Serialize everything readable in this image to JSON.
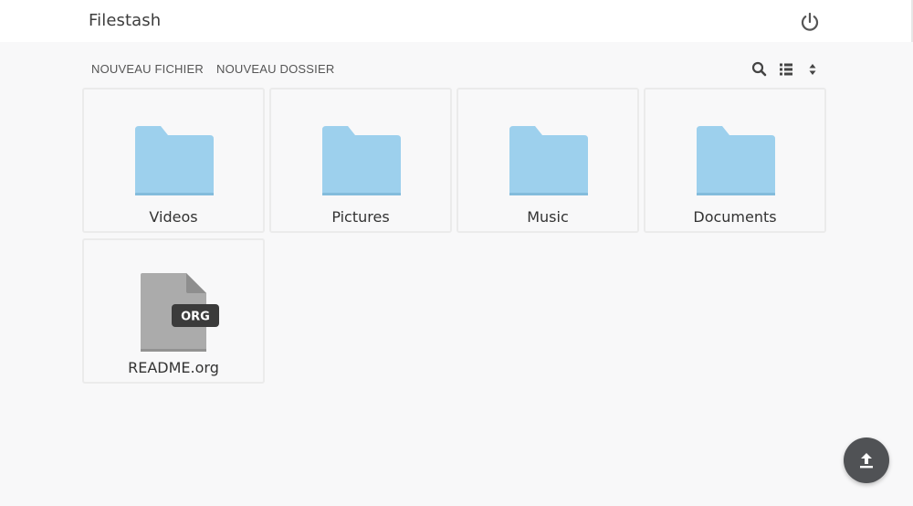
{
  "app": {
    "title": "Filestash"
  },
  "toolbar": {
    "new_file_label": "NOUVEAU FICHIER",
    "new_folder_label": "NOUVEAU DOSSIER",
    "icons": [
      "search-icon",
      "list-view-icon",
      "sort-icon"
    ]
  },
  "files": [
    {
      "name": "Videos",
      "type": "folder"
    },
    {
      "name": "Pictures",
      "type": "folder"
    },
    {
      "name": "Music",
      "type": "folder"
    },
    {
      "name": "Documents",
      "type": "folder"
    },
    {
      "name": "README.org",
      "type": "file",
      "badge": "ORG"
    }
  ],
  "colors": {
    "folder": "#9dd0ed",
    "folder_tab": "#9ad0ed",
    "file": "#ababab",
    "file_corner": "#8e8e8e",
    "badge_bg": "#3b3b3b",
    "fab_bg": "#505255"
  }
}
